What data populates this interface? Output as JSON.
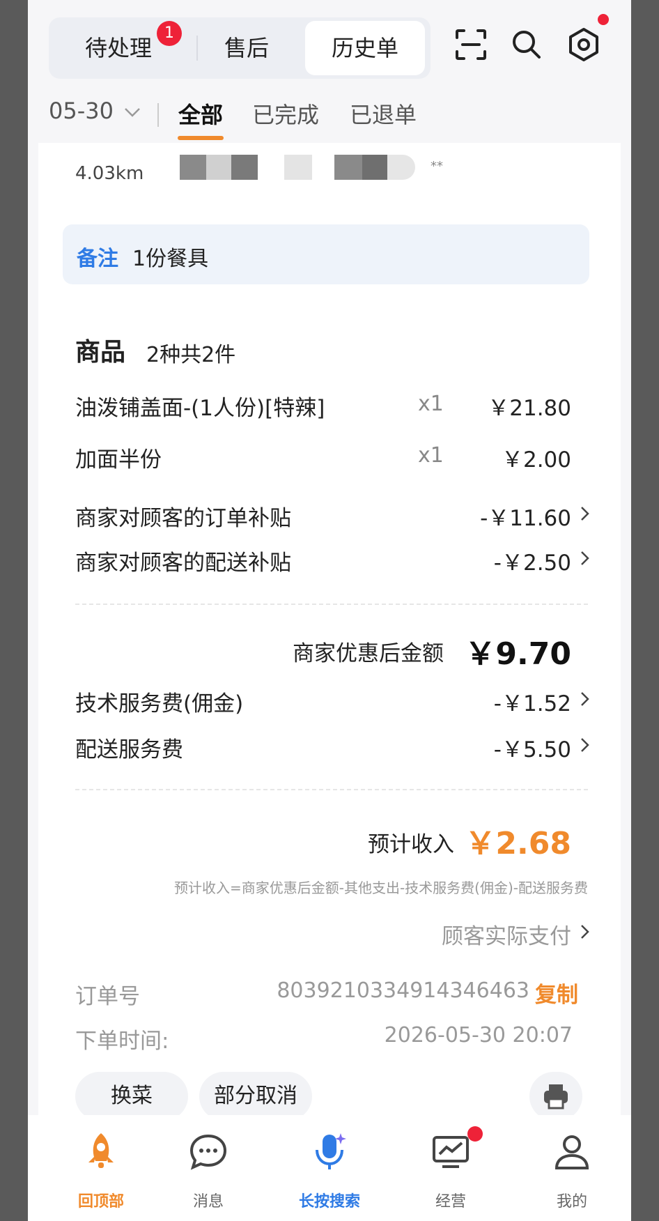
{
  "header": {
    "tabs": [
      {
        "label": "待处理",
        "badge": "1"
      },
      {
        "label": "售后"
      },
      {
        "label": "历史单"
      }
    ]
  },
  "filters": {
    "date": "05-30",
    "options": [
      "全部",
      "已完成",
      "已退单"
    ],
    "active": "全部"
  },
  "customer": {
    "distance": "4.03km",
    "masked_suffix": "**"
  },
  "note": {
    "label": "备注",
    "value": "1份餐具"
  },
  "goods": {
    "title": "商品",
    "summary": "2种共2件",
    "items": [
      {
        "name": "油泼铺盖面-(1人份)[特辣]",
        "qty": "x1",
        "price": "￥21.80"
      },
      {
        "name": "加面半份",
        "qty": "x1",
        "price": "￥2.00"
      }
    ],
    "subsidies": [
      {
        "label": "商家对顾客的订单补贴",
        "amount": "-￥11.60"
      },
      {
        "label": "商家对顾客的配送补贴",
        "amount": "-￥2.50"
      }
    ]
  },
  "after_discount": {
    "label": "商家优惠后金额",
    "amount": "￥9.70"
  },
  "fees": [
    {
      "label": "技术服务费(佣金)",
      "amount": "-￥1.52"
    },
    {
      "label": "配送服务费",
      "amount": "-￥5.50"
    }
  ],
  "income": {
    "label": "预计收入",
    "amount": "￥2.68",
    "formula": "预计收入=商家优惠后金额-其他支出-技术服务费(佣金)-配送服务费",
    "customer_paid_link": "顾客实际支付"
  },
  "order": {
    "number_label": "订单号",
    "number": "8039210334914346463",
    "copy": "复制",
    "time_label": "下单时间:",
    "time": "2026-05-30 20:07"
  },
  "actions": {
    "swap": "换菜",
    "partial_cancel": "部分取消"
  },
  "tabbar": [
    {
      "label": "回顶部",
      "icon": "rocket-icon",
      "active": true
    },
    {
      "label": "消息",
      "icon": "chat-icon"
    },
    {
      "label": "长按搜索",
      "icon": "voice-search-icon"
    },
    {
      "label": "经营",
      "icon": "business-chart-icon",
      "dot": true
    },
    {
      "label": "我的",
      "icon": "profile-icon"
    }
  ],
  "colors": {
    "accent": "#f08a2c",
    "blue": "#2f7be5",
    "badge": "#ee2238"
  }
}
